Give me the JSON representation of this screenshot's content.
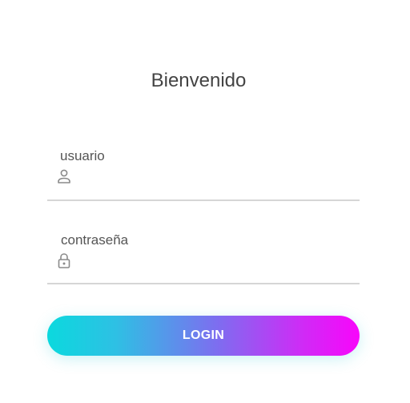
{
  "page": {
    "title": "Bienvenido"
  },
  "form": {
    "username": {
      "label": "usuario",
      "value": "",
      "icon": "person-icon"
    },
    "password": {
      "label": "contraseña",
      "value": "",
      "icon": "lock-icon"
    },
    "login_label": "LOGIN"
  },
  "colors": {
    "gradient_start": "#0bd9de",
    "gradient_end": "#f806fb",
    "text": "#444444",
    "underline": "#d6d6d6"
  }
}
